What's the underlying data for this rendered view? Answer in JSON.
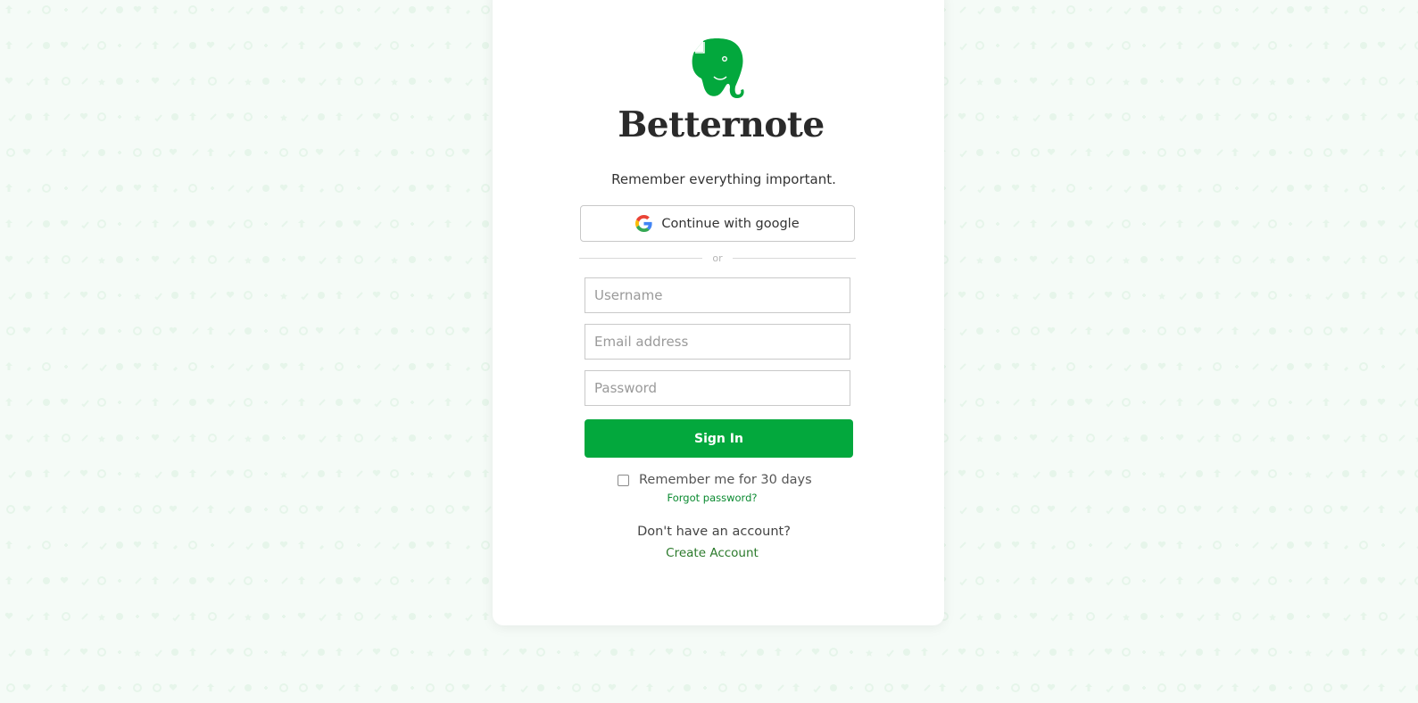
{
  "brand": {
    "name": "Betternote",
    "tagline": "Remember everything important.",
    "accent_color": "#03a83d",
    "logo_icon": "elephant-logo-icon"
  },
  "google": {
    "label": "Continue with google",
    "icon": "google-g-icon"
  },
  "divider": {
    "text": "or"
  },
  "form": {
    "username": {
      "value": "",
      "placeholder": "Username"
    },
    "email": {
      "value": "",
      "placeholder": "Email address"
    },
    "password": {
      "value": "",
      "placeholder": "Password"
    },
    "submit_label": "Sign In",
    "remember_label": "Remember me for 30 days",
    "remember_checked": false,
    "forgot_label": "Forgot password?"
  },
  "signup": {
    "prompt": "Don't have an account?",
    "link_label": "Create Account"
  }
}
